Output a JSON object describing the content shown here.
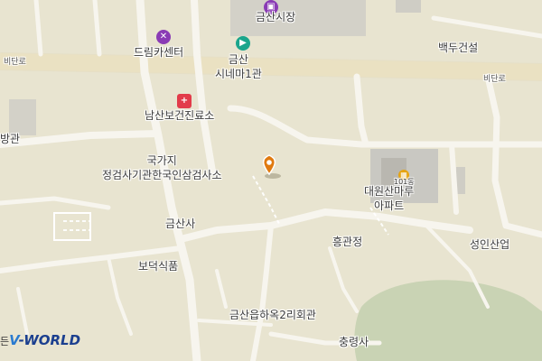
{
  "map": {
    "road_labels": [
      "비단로",
      "비단로"
    ],
    "places": [
      {
        "name": "금산시장"
      },
      {
        "name": "드림카센터"
      },
      {
        "name": "금산\n시네마1관"
      },
      {
        "name": "백두건설"
      },
      {
        "name": "남산보건진료소"
      },
      {
        "name": "방관"
      },
      {
        "name": "국가지\n정검사기관한국인삼검사소"
      },
      {
        "name": "101동"
      },
      {
        "name": "대원산마루\n아파트"
      },
      {
        "name": "금산사"
      },
      {
        "name": "흥관정"
      },
      {
        "name": "성인산업"
      },
      {
        "name": "보덕식품"
      },
      {
        "name": "금산읍하옥2리회관"
      },
      {
        "name": "충령사"
      }
    ],
    "icons": {
      "market": "shopping-bag-icon",
      "car_center": "wrench-icon",
      "cinema": "film-camera-icon",
      "clinic": "hospital-icon",
      "apartment": "building-icon",
      "marker": "location-pin-icon"
    },
    "colors": {
      "background": "#e8e4d0",
      "road": "#f7f5ee",
      "main_road": "#efe7c9",
      "park": "#c9d3b4",
      "building": "#c9c8c2",
      "marker": "#e07a10"
    }
  },
  "logo": {
    "prefix": "든",
    "text_v": "V",
    "text_rest": "-WORLD"
  }
}
